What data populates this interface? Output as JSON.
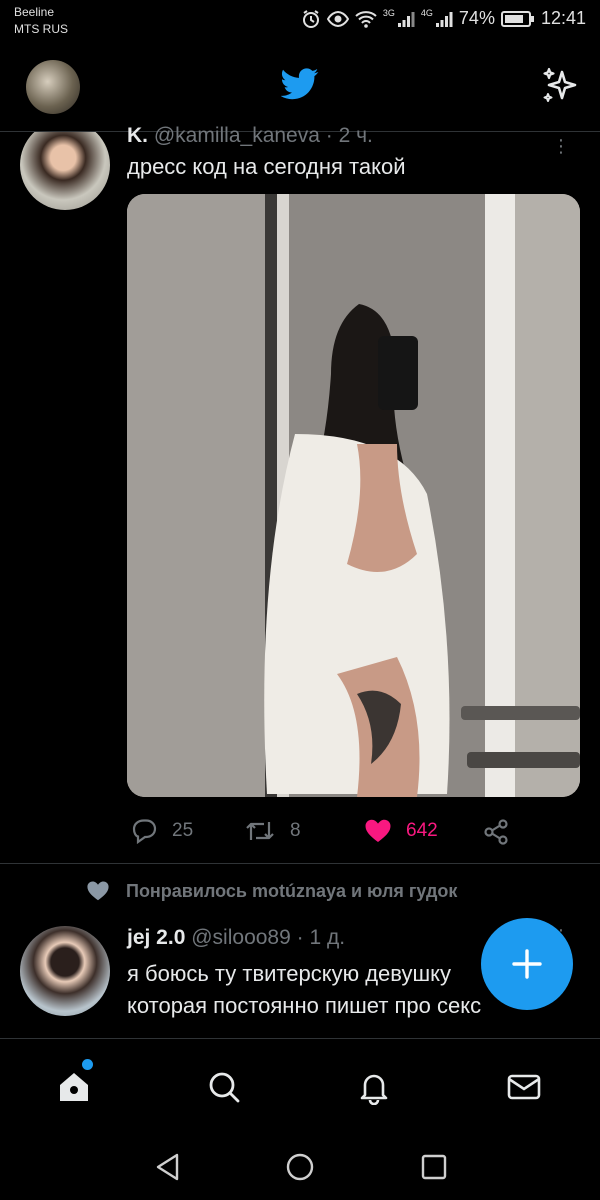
{
  "status_bar": {
    "carrier_1": "Beeline",
    "carrier_2": "MTS RUS",
    "net_1": "3G",
    "net_2": "4G",
    "battery": "74%",
    "time": "12:41"
  },
  "app_bar": {
    "logo_icon": "twitter-bird-icon",
    "sparkle_icon": "sparkle-icon"
  },
  "tweet1": {
    "name": "K.",
    "handle": "@kamilla_kaneva · 2 ч.",
    "text": "дресс код на сегодня такой",
    "replies": "25",
    "retweets": "8",
    "likes": "642"
  },
  "liked_notice": "Понравилось motúznaya и юля гудок",
  "tweet2": {
    "name": "jej 2.0",
    "handle": "@silooo89 · 1 д.",
    "text_line1": "я боюсь ту твитерскую девушку",
    "text_line2": "которая постоянно пишет про секс"
  },
  "colors": {
    "accent": "#1d9bf0",
    "like": "#f91880",
    "muted": "#71767b",
    "divider": "#2f3336"
  },
  "bottom_nav": [
    "home-icon",
    "search-icon",
    "notifications-icon",
    "messages-icon"
  ],
  "system_nav": [
    "back-icon",
    "home-circle-icon",
    "recents-icon"
  ]
}
